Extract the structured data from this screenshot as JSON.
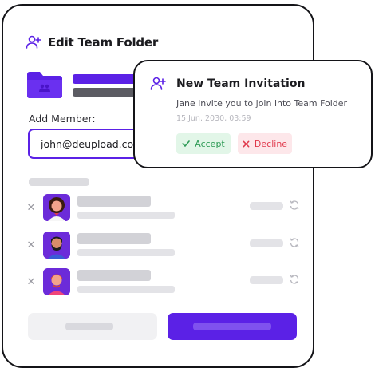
{
  "edit_panel": {
    "title": "Edit Team Folder",
    "header_icon": "user-plus-icon",
    "folder_icon": "folder-icon",
    "add_member_label": "Add Member:",
    "member_input_value": "john@deupload.com",
    "members": [
      {
        "avatar": "woman-avatar",
        "remove_icon": "close-icon",
        "sync_icon": "refresh-icon"
      },
      {
        "avatar": "bearded-man-avatar",
        "remove_icon": "close-icon",
        "sync_icon": "refresh-icon"
      },
      {
        "avatar": "man-avatar",
        "remove_icon": "close-icon",
        "sync_icon": "refresh-icon"
      }
    ]
  },
  "invitation": {
    "icon": "user-plus-icon",
    "title": "New Team Invitation",
    "message": "Jane invite you to join into Team Folder",
    "timestamp": "15 Jun. 2030, 03:59",
    "accept_label": "Accept",
    "decline_label": "Decline"
  },
  "colors": {
    "accent": "#5b21e6",
    "accept_bg": "#e2f6e8",
    "accept_text": "#2d9a55",
    "decline_bg": "#fde7ea",
    "decline_text": "#e0384b"
  }
}
